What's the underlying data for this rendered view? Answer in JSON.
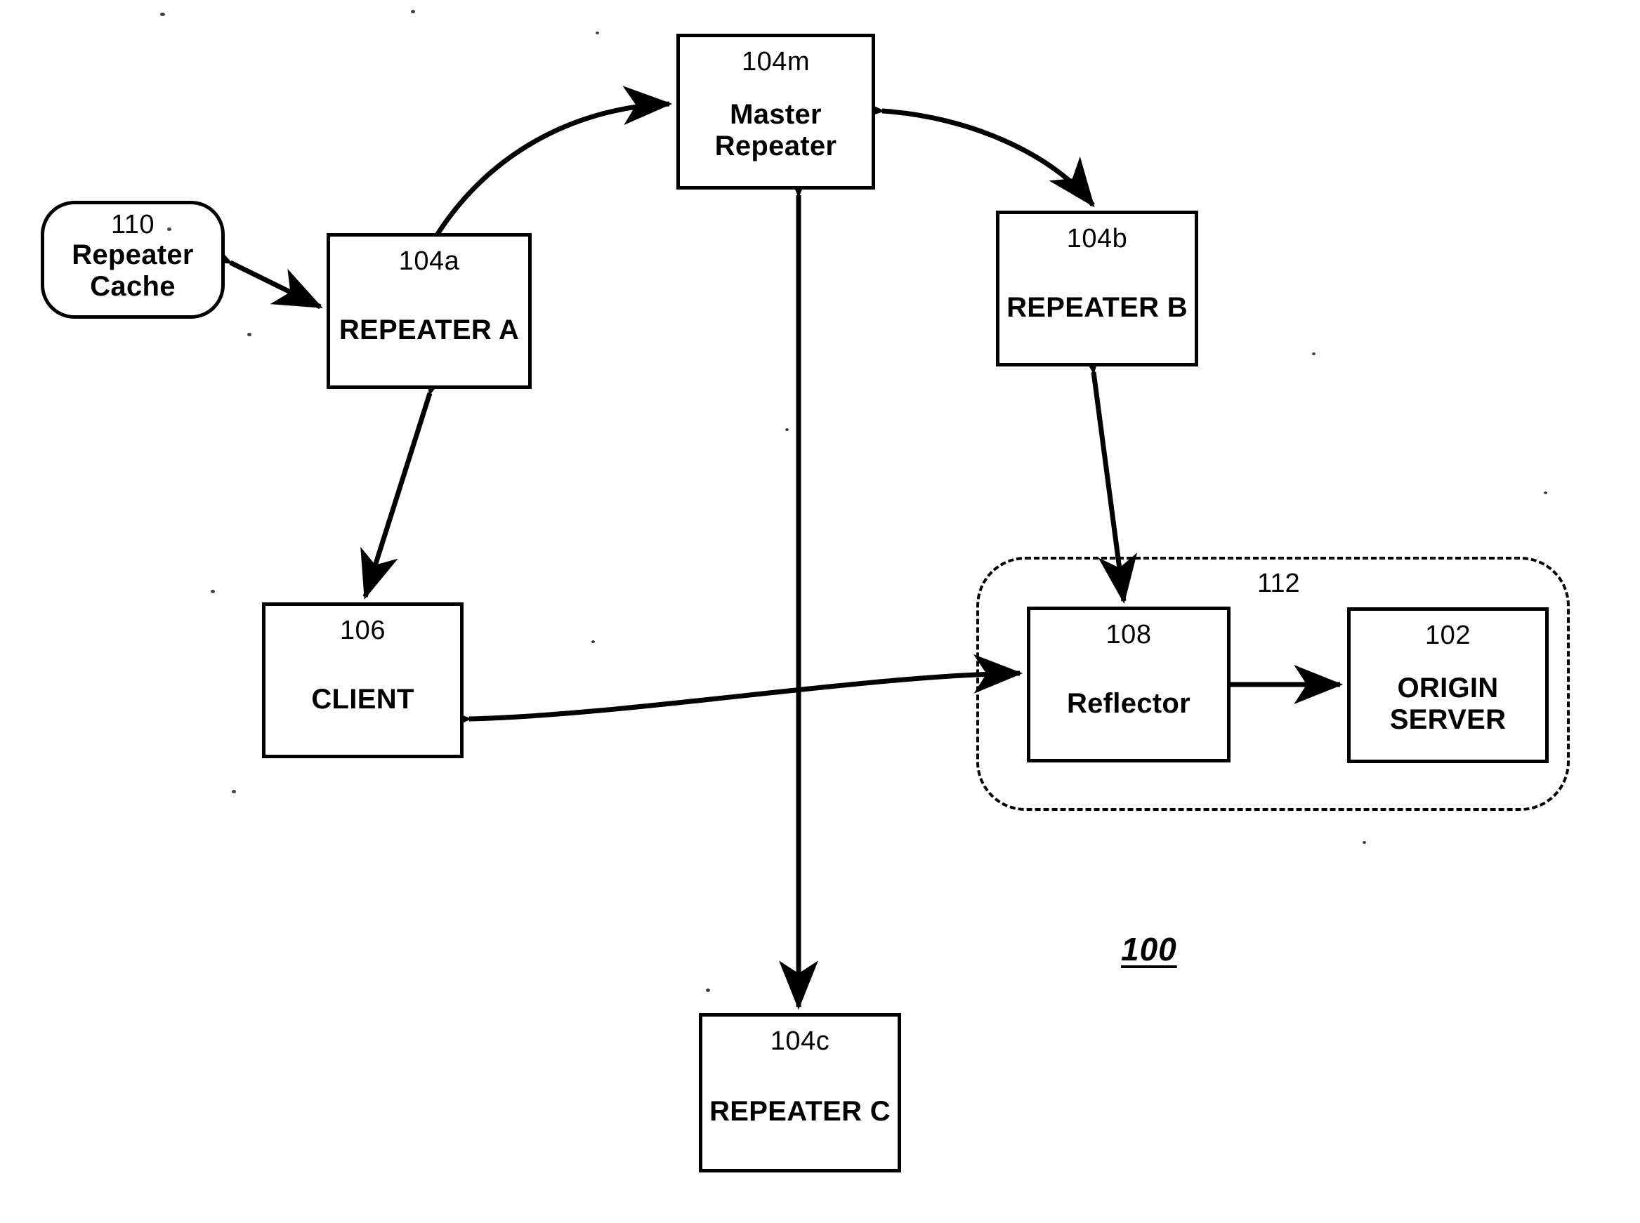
{
  "figure": {
    "figure_number": "100",
    "nodes": [
      {
        "id": "master-repeater",
        "ref": "104m",
        "label": "Master\nRepeater",
        "shape": "rect",
        "label_style": "bold"
      },
      {
        "id": "repeater-cache",
        "ref": "110",
        "label": "Repeater\nCache",
        "shape": "rounded-rect",
        "label_style": "bold"
      },
      {
        "id": "repeater-a",
        "ref": "104a",
        "label": "REPEATER A",
        "shape": "rect",
        "label_style": "bold"
      },
      {
        "id": "repeater-b",
        "ref": "104b",
        "label": "REPEATER B",
        "shape": "rect",
        "label_style": "bold"
      },
      {
        "id": "repeater-c",
        "ref": "104c",
        "label": "REPEATER C",
        "shape": "rect",
        "label_style": "bold"
      },
      {
        "id": "client",
        "ref": "106",
        "label": "CLIENT",
        "shape": "rect",
        "label_style": "bold"
      },
      {
        "id": "reflector",
        "ref": "108",
        "label": "Reflector",
        "shape": "rect",
        "label_style": "bold"
      },
      {
        "id": "origin-server",
        "ref": "102",
        "label": "ORIGIN\nSERVER",
        "shape": "rect",
        "label_style": "bold"
      }
    ],
    "groups": [
      {
        "id": "origin-site-group",
        "ref": "112",
        "style": "dashed-rounded",
        "contains": [
          "reflector",
          "origin-server"
        ]
      }
    ],
    "connections": [
      {
        "from": "repeater-a",
        "to": "master-repeater",
        "style": "curved",
        "arrows": "both"
      },
      {
        "from": "master-repeater",
        "to": "repeater-b",
        "style": "curved",
        "arrows": "both"
      },
      {
        "from": "master-repeater",
        "to": "repeater-c",
        "style": "straight-vertical",
        "arrows": "both"
      },
      {
        "from": "repeater-cache",
        "to": "repeater-a",
        "style": "straight-diagonal",
        "arrows": "both"
      },
      {
        "from": "repeater-a",
        "to": "client",
        "style": "straight-diagonal",
        "arrows": "both"
      },
      {
        "from": "client",
        "to": "reflector",
        "style": "curved",
        "arrows": "both"
      },
      {
        "from": "repeater-b",
        "to": "reflector",
        "style": "straight",
        "arrows": "both"
      },
      {
        "from": "reflector",
        "to": "origin-server",
        "style": "straight",
        "arrows": "both"
      }
    ],
    "colors": {
      "line": "#000000",
      "background": "#ffffff",
      "text": "#000000"
    }
  },
  "labels": {
    "master_repeater_ref": "104m",
    "master_repeater_line1": "Master",
    "master_repeater_line2": "Repeater",
    "repeater_cache_ref": "110",
    "repeater_cache_line1": "Repeater",
    "repeater_cache_line2": "Cache",
    "repeater_a_ref": "104a",
    "repeater_a_name": "REPEATER A",
    "repeater_b_ref": "104b",
    "repeater_b_name": "REPEATER B",
    "repeater_c_ref": "104c",
    "repeater_c_name": "REPEATER C",
    "client_ref": "106",
    "client_name": "CLIENT",
    "reflector_ref": "108",
    "reflector_name": "Reflector",
    "origin_server_ref": "102",
    "origin_server_line1": "ORIGIN",
    "origin_server_line2": "SERVER",
    "group_ref": "112",
    "figure_number": "100"
  }
}
